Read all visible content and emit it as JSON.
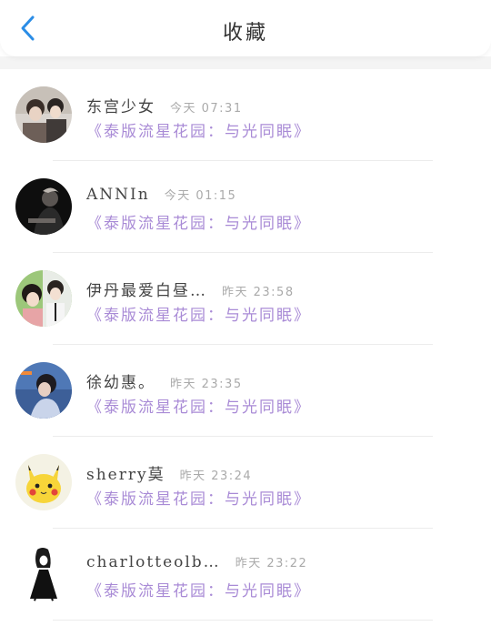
{
  "header": {
    "title": "收藏",
    "back_icon": "back-chevron-icon"
  },
  "accent": "#2b8de6",
  "subtitle_color": "#a98bd6",
  "items": [
    {
      "name": "东宫少女",
      "time": "今天 07:31",
      "subtitle": "《泰版流星花园：与光同眠》",
      "avatar": "avatar-photo-couple"
    },
    {
      "name": "ANNIn",
      "time": "今天 01:15",
      "subtitle": "《泰版流星花园：与光同眠》",
      "avatar": "avatar-photo-dark"
    },
    {
      "name": "伊丹最爱白昼…",
      "time": "昨天 23:58",
      "subtitle": "《泰版流星花园：与光同眠》",
      "avatar": "avatar-photo-pair"
    },
    {
      "name": "徐幼惠。",
      "time": "昨天 23:35",
      "subtitle": "《泰版流星花园：与光同眠》",
      "avatar": "avatar-photo-blue"
    },
    {
      "name": "sherry莫",
      "time": "昨天 23:24",
      "subtitle": "《泰版流星花园：与光同眠》",
      "avatar": "avatar-pikachu"
    },
    {
      "name": "charlotteolb…",
      "time": "昨天 23:22",
      "subtitle": "《泰版流星花园：与光同眠》",
      "avatar": "avatar-sketch-girl"
    }
  ]
}
